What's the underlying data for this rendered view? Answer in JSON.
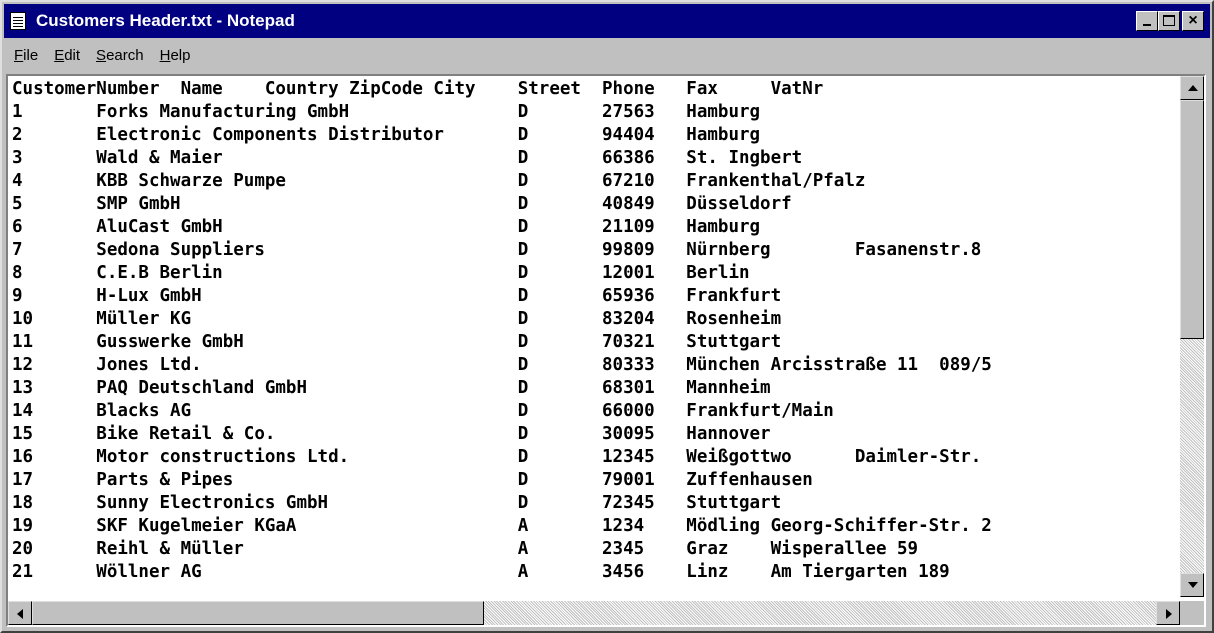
{
  "window": {
    "title": "Customers Header.txt - Notepad",
    "close_glyph": "×"
  },
  "menu": [
    {
      "accel": "F",
      "rest": "ile"
    },
    {
      "accel": "E",
      "rest": "dit"
    },
    {
      "accel": "S",
      "rest": "earch"
    },
    {
      "accel": "H",
      "rest": "elp"
    }
  ],
  "document": {
    "header": "CustomerNumber  Name    Country ZipCode City    Street  Phone   Fax     VatNr",
    "rows": [
      "1       Forks Manufacturing GmbH                D       27563   Hamburg",
      "2       Electronic Components Distributor       D       94404   Hamburg",
      "3       Wald & Maier                            D       66386   St. Ingbert",
      "4       KBB Schwarze Pumpe                      D       67210   Frankenthal/Pfalz",
      "5       SMP GmbH                                D       40849   Düsseldorf",
      "6       AluCast GmbH                            D       21109   Hamburg",
      "7       Sedona Suppliers                        D       99809   Nürnberg        Fasanenstr.8",
      "8       C.E.B Berlin                            D       12001   Berlin",
      "9       H-Lux GmbH                              D       65936   Frankfurt",
      "10      Müller KG                               D       83204   Rosenheim",
      "11      Gusswerke GmbH                          D       70321   Stuttgart",
      "12      Jones Ltd.                              D       80333   München Arcisstraße 11  089/5",
      "13      PAQ Deutschland GmbH                    D       68301   Mannheim",
      "14      Blacks AG                               D       66000   Frankfurt/Main",
      "15      Bike Retail & Co.                       D       30095   Hannover",
      "16      Motor constructions Ltd.                D       12345   Weißgottwo      Daimler-Str.",
      "17      Parts & Pipes                           D       79001   Zuffenhausen",
      "18      Sunny Electronics GmbH                  D       72345   Stuttgart",
      "19      SKF Kugelmeier KGaA                     A       1234    Mödling Georg-Schiffer-Str. 2",
      "20      Reihl & Müller                          A       2345    Graz    Wisperallee 59",
      "21      Wöllner AG                              A       3456    Linz    Am Tiergarten 189"
    ]
  }
}
